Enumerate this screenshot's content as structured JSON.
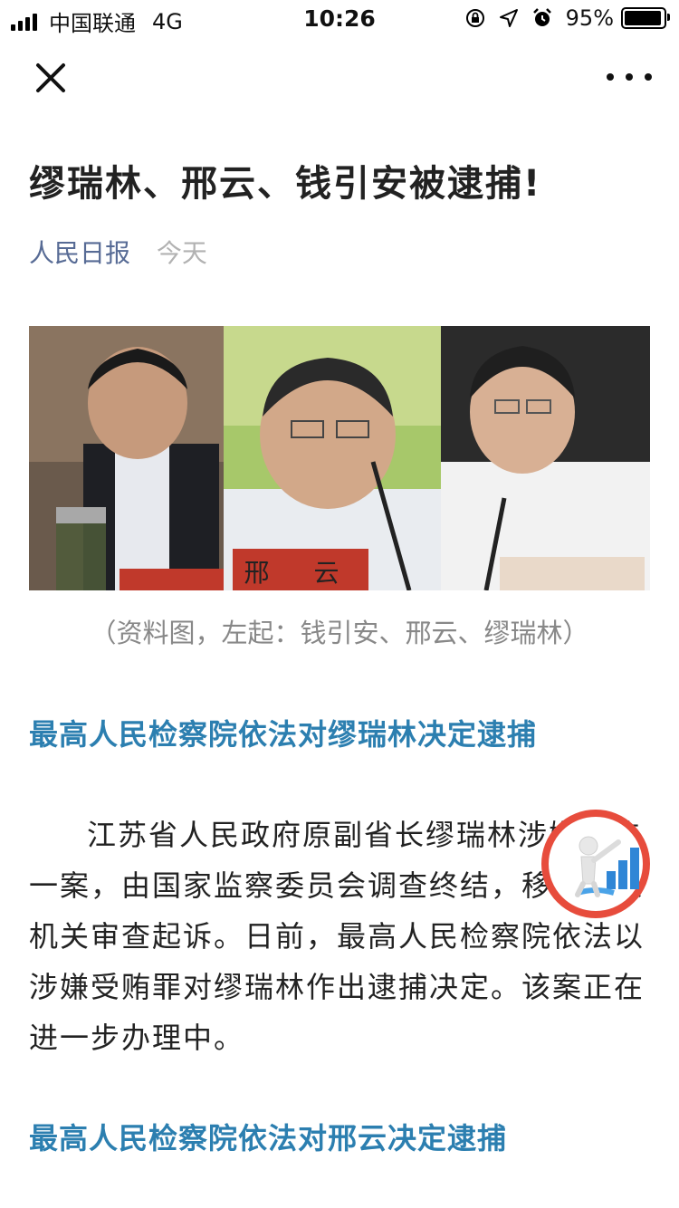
{
  "status": {
    "carrier": "中国联通",
    "network": "4G",
    "time": "10:26",
    "battery": "95%",
    "battery_level": 0.95
  },
  "nav": {
    "close_icon": "close-icon",
    "more_icon": "more-icon"
  },
  "article": {
    "title": "缪瑞林、邢云、钱引安被逮捕!",
    "author": "人民日报",
    "date": "今天",
    "image_caption": "（资料图，左起：钱引安、邢云、缪瑞林）",
    "image_nameplate": "邢 云",
    "section1_heading": "最高人民检察院依法对缪瑞林决定逮捕",
    "section1_body": "江苏省人民政府原副省长缪瑞林涉嫌受贿一案，由国家监察委员会调查终结，移送检察机关审查起诉。日前，最高人民检察院依法以涉嫌受贿罪对缪瑞林作出逮捕决定。该案正在进一步办理中。",
    "section2_heading": "最高人民检察院依法对邢云决定逮捕"
  },
  "colors": {
    "link_blue": "#576b95",
    "heading_blue": "#2c7fb0",
    "float_ring": "#e74c3c"
  }
}
